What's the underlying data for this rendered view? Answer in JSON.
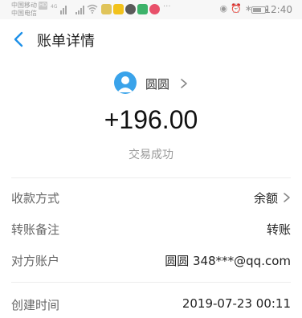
{
  "status_bar": {
    "carrier_1": "中国移动",
    "carrier_badge": "HD",
    "carrier_2": "中国电信",
    "signal_label": "4G",
    "time": "12:40",
    "icons": [
      "signal-icon",
      "wifi-icon",
      "notification-icon",
      "eye-icon",
      "alarm-icon",
      "bluetooth-icon",
      "battery-icon"
    ]
  },
  "nav": {
    "title": "账单详情",
    "back_icon": "chevron-left-icon"
  },
  "summary": {
    "counterparty_name": "圆圆",
    "amount": "+196.00",
    "status": "交易成功"
  },
  "details": {
    "rows": [
      {
        "label": "收款方式",
        "value": "余额"
      },
      {
        "label": "转账备注",
        "value": "转账"
      },
      {
        "label": "对方账户",
        "value": "圆圆 348***@qq.com"
      },
      {
        "label": "创建时间",
        "value": "2019-07-23 00:11"
      }
    ]
  },
  "colors": {
    "accent": "#1e90e8",
    "avatar": "#3aa3ea",
    "label": "#666666",
    "divider": "#ececec"
  }
}
